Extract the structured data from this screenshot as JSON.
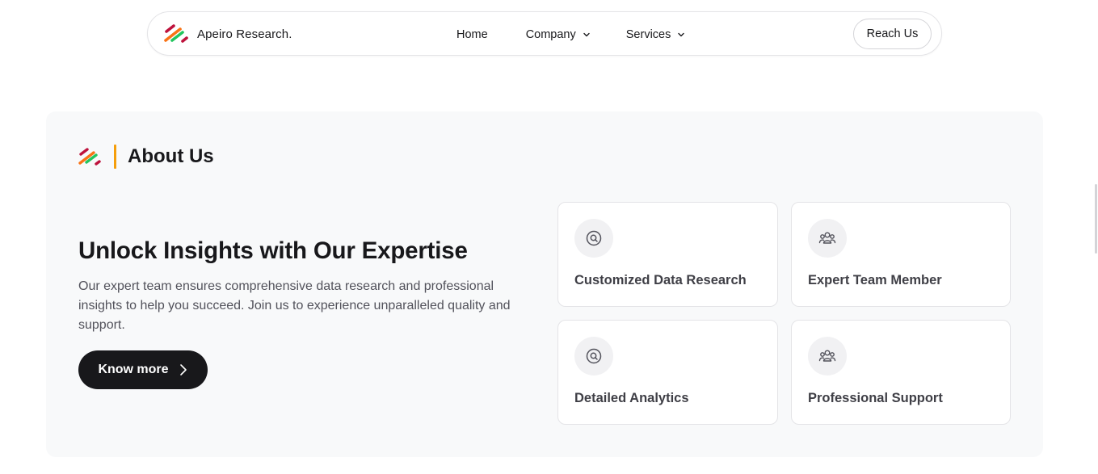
{
  "nav": {
    "brand": "Apeiro Research.",
    "links": [
      {
        "label": "Home"
      },
      {
        "label": "Company"
      },
      {
        "label": "Services"
      }
    ],
    "cta": "Reach Us"
  },
  "about": {
    "heading": "About Us",
    "headline": "Unlock Insights with Our Expertise",
    "description": "Our expert team ensures comprehensive data research and professional insights to help you succeed. Join us to experience unparalleled quality and support.",
    "button": "Know more",
    "cards": [
      {
        "label": "Customized Data Research",
        "icon": "search-icon"
      },
      {
        "label": "Expert Team Member",
        "icon": "team-icon"
      },
      {
        "label": "Detailed Analytics",
        "icon": "search-icon"
      },
      {
        "label": "Professional Support",
        "icon": "team-icon"
      }
    ]
  },
  "colors": {
    "accent_orange": "#f59e0b",
    "logo_red": "#be123c",
    "logo_green": "#22c55e",
    "logo_orange": "#f97316",
    "button_dark": "#18181b",
    "section_bg": "#f8f9fa"
  }
}
